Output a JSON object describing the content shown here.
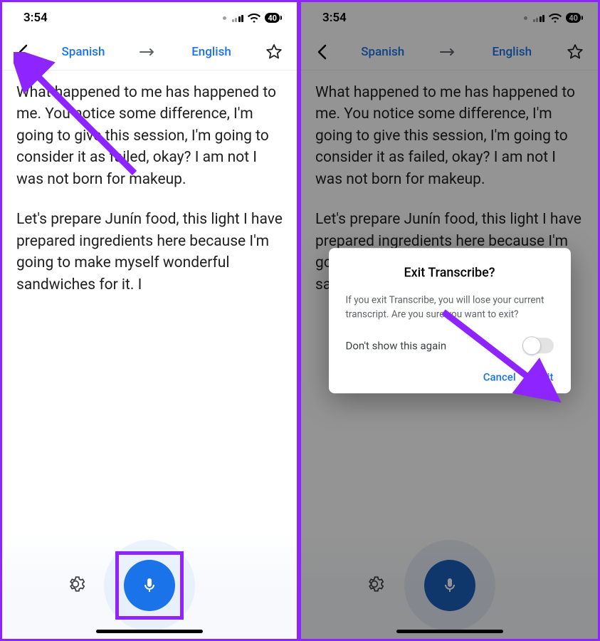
{
  "status": {
    "time": "3:54",
    "battery": "40"
  },
  "nav": {
    "source_lang": "Spanish",
    "target_lang": "English"
  },
  "transcript": {
    "para1": "What happened to me has happened to me. You notice some difference, I'm going to give this session, I'm going to consider it as failed, okay? I am not I was not born for makeup.",
    "para2": "Let's prepare Junín food, this light I have prepared ingredients here because I'm going to make myself wonderful sandwiches for it. I"
  },
  "dialog": {
    "title": "Exit Transcribe?",
    "body": "If you exit Transcribe, you will lose your current transcript. Are you sure you want to exit?",
    "dont_show": "Don't show this again",
    "cancel": "Cancel",
    "exit": "Exit"
  }
}
